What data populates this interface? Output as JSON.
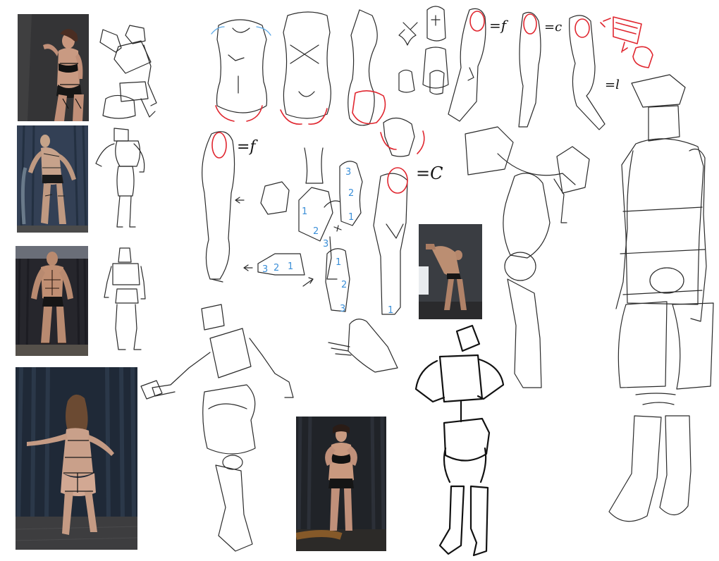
{
  "annotations": {
    "eq_f_1": "=f",
    "eq_c_1": "=c",
    "eq_l": "=l",
    "eq_f_2": "=f",
    "eq_c_2": "=C"
  },
  "leg_section_numbers": {
    "top": [
      "3",
      "2",
      "1"
    ],
    "knee": [
      "1",
      "2",
      "3"
    ],
    "bottom": [
      "1",
      "2",
      "3"
    ],
    "foot": [
      "3",
      "2",
      "1"
    ],
    "shin": "1"
  },
  "colors": {
    "background": "#ffffff",
    "sketch_line": "#2a2a2a",
    "highlight_red": "#e0262f",
    "highlight_blue": "#5aa8e6",
    "number_blue": "#3b8fd8",
    "curtain_dark": "#2b3440"
  }
}
